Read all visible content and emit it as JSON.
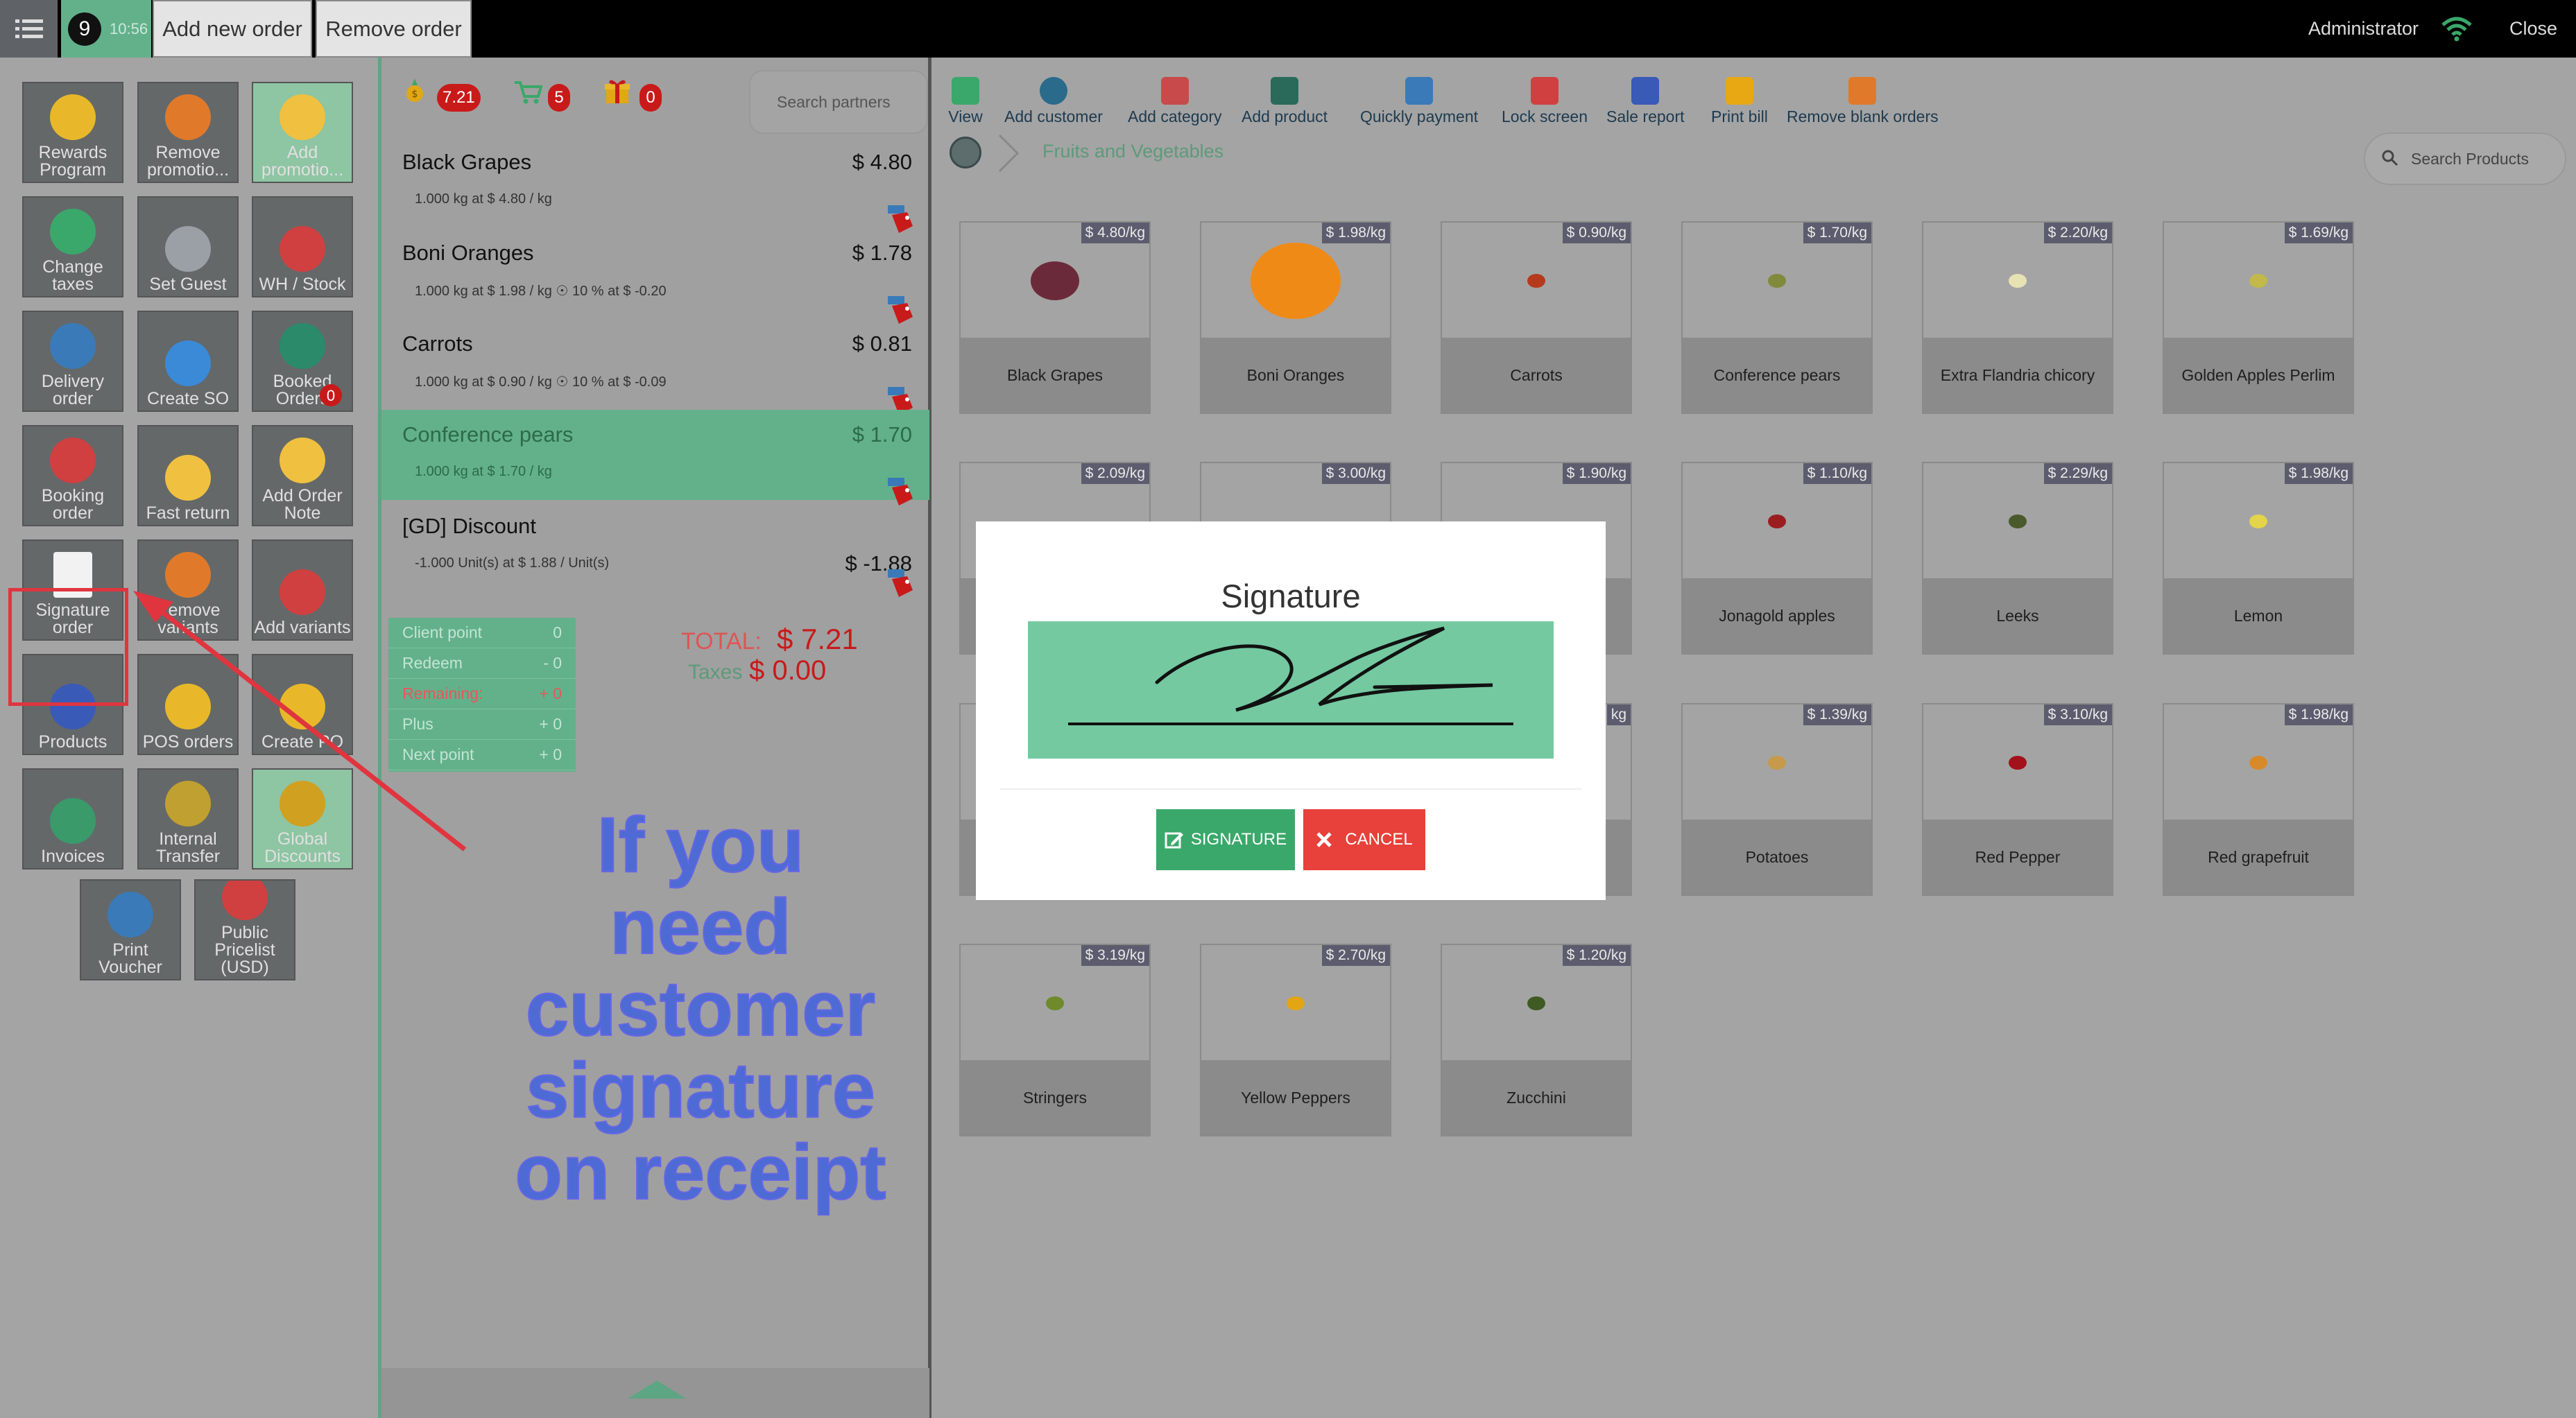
{
  "topbar": {
    "order_number": "9",
    "order_time": "10:56",
    "add_order_label": "Add new order",
    "remove_order_label": "Remove order",
    "user": "Administrator",
    "close_label": "Close"
  },
  "left": {
    "tiles": [
      {
        "label": "Rewards Program",
        "icon": "medal-icon"
      },
      {
        "label": "Remove promotio...",
        "icon": "trash-icon"
      },
      {
        "label": "Add promotio...",
        "icon": "promo-icon"
      },
      {
        "label": "Change taxes",
        "icon": "taxes-icon"
      },
      {
        "label": "Set Guest",
        "icon": "guests-icon"
      },
      {
        "label": "WH / Stock",
        "icon": "warehouse-icon"
      },
      {
        "label": "Delivery order",
        "icon": "delivery-icon"
      },
      {
        "label": "Create SO",
        "icon": "cart-icon"
      },
      {
        "label": "Booked Orders",
        "icon": "booked-icon",
        "badge": "0"
      },
      {
        "label": "Booking order",
        "icon": "booking-icon"
      },
      {
        "label": "Fast return",
        "icon": "coin-icon"
      },
      {
        "label": "Add Order Note",
        "icon": "note-icon"
      },
      {
        "label": "Signature order",
        "icon": "signature-icon"
      },
      {
        "label": "Remove variants",
        "icon": "trash-icon"
      },
      {
        "label": "Add variants",
        "icon": "variants-icon"
      },
      {
        "label": "Products",
        "icon": "barcode-icon"
      },
      {
        "label": "POS orders",
        "icon": "search-orders-icon"
      },
      {
        "label": "Create PO",
        "icon": "basket-icon"
      },
      {
        "label": "Invoices",
        "icon": "invoices-icon"
      },
      {
        "label": "Internal Transfer",
        "icon": "truck-icon"
      },
      {
        "label": "Global Discounts",
        "icon": "discount-tag-icon"
      },
      {
        "label": "Print Voucher",
        "icon": "voucher-icon"
      },
      {
        "label": "Public Pricelist (USD)",
        "icon": "pricelist-icon"
      }
    ]
  },
  "middle": {
    "badges": {
      "points": "7.21",
      "cart": "5",
      "gift": "0"
    },
    "search_placeholder": "Search partners",
    "lines": [
      {
        "name": "Black Grapes",
        "price": "$ 4.80",
        "detail": "1.000 kg at $ 4.80 / kg",
        "discount": ""
      },
      {
        "name": "Boni Oranges",
        "price": "$ 1.78",
        "detail": "1.000 kg at $ 1.98 / kg",
        "discount": "10 % at $ -0.20"
      },
      {
        "name": "Carrots",
        "price": "$ 0.81",
        "detail": "1.000 kg at $ 0.90 / kg",
        "discount": "10 % at $ -0.09"
      },
      {
        "name": "Conference pears",
        "price": "$ 1.70",
        "detail": "1.000 kg at $ 1.70 / kg",
        "discount": ""
      },
      {
        "name": "[GD] Discount",
        "price": "$ -1.88",
        "detail": "-1.000 Unit(s) at $ 1.88 / Unit(s)",
        "discount": ""
      }
    ],
    "points": [
      {
        "label": "Client point",
        "value": "0"
      },
      {
        "label": "Redeem",
        "value": "- 0"
      },
      {
        "label": "Remaining:",
        "value": "+ 0"
      },
      {
        "label": "Plus",
        "value": "+ 0"
      },
      {
        "label": "Next point",
        "value": "+ 0"
      }
    ],
    "total_label": "TOTAL:",
    "total_value": "$ 7.21",
    "taxes_label": "Taxes",
    "taxes_value": "$ 0.00"
  },
  "right": {
    "toolbar": [
      {
        "label": "View",
        "icon": "checklist-icon"
      },
      {
        "label": "Add customer",
        "icon": "user-icon"
      },
      {
        "label": "Add category",
        "icon": "hierarchy-icon"
      },
      {
        "label": "Add product",
        "icon": "add-product-icon"
      },
      {
        "label": "Quickly payment",
        "icon": "payment-icon"
      },
      {
        "label": "Lock screen",
        "icon": "monitor-icon"
      },
      {
        "label": "Sale report",
        "icon": "report-icon"
      },
      {
        "label": "Print bill",
        "icon": "printer-icon"
      },
      {
        "label": "Remove blank orders",
        "icon": "trash-icon"
      }
    ],
    "breadcrumb": "Fruits and Vegetables",
    "search_placeholder": "Search Products",
    "products": [
      {
        "name": "Black Grapes",
        "price": "$ 4.80/kg",
        "color": "#6b2a3a"
      },
      {
        "name": "Boni Oranges",
        "price": "$ 1.98/kg",
        "color": "#f08a16"
      },
      {
        "name": "Carrots",
        "price": "$ 0.90/kg",
        "color": "#b53a1c"
      },
      {
        "name": "Conference pears",
        "price": "$ 1.70/kg",
        "color": "#7f8a3a"
      },
      {
        "name": "Extra Flandria chicory",
        "price": "$ 2.20/kg",
        "color": "#e7e2b4"
      },
      {
        "name": "Golden Apples Perlim",
        "price": "$ 1.69/kg",
        "color": "#c2b94a"
      },
      {
        "name": "",
        "price": "$ 2.09/kg",
        "color": ""
      },
      {
        "name": "",
        "price": "$ 3.00/kg",
        "color": ""
      },
      {
        "name": "",
        "price": "$ 1.90/kg",
        "color": ""
      },
      {
        "name": "Jonagold apples",
        "price": "$ 1.10/kg",
        "color": "#9b1d20"
      },
      {
        "name": "Leeks",
        "price": "$ 2.29/kg",
        "color": "#4a5a2c"
      },
      {
        "name": "Lemon",
        "price": "$ 1.98/kg",
        "color": "#e4d44a"
      },
      {
        "name": "",
        "price": "",
        "color": ""
      },
      {
        "name": "",
        "price": "",
        "color": ""
      },
      {
        "name": "",
        "price": "kg",
        "color": ""
      },
      {
        "name": "Potatoes",
        "price": "$ 1.39/kg",
        "color": "#c69a4a"
      },
      {
        "name": "Red Pepper",
        "price": "$ 3.10/kg",
        "color": "#a3121b"
      },
      {
        "name": "Red grapefruit",
        "price": "$ 1.98/kg",
        "color": "#d88a2a"
      },
      {
        "name": "Stringers",
        "price": "$ 3.19/kg",
        "color": "#6f8a2a"
      },
      {
        "name": "Yellow Peppers",
        "price": "$ 2.70/kg",
        "color": "#e2a514"
      },
      {
        "name": "Zucchini",
        "price": "$ 1.20/kg",
        "color": "#3f5a22"
      }
    ]
  },
  "annotation": "If you need customer signature on receipt",
  "modal": {
    "title": "Signature",
    "sign_label": "SIGNATURE",
    "cancel_label": "CANCEL"
  },
  "colors": {
    "accent_green": "#62b18b",
    "badge_red": "#c91a1a",
    "highlight_red": "#e0353f",
    "annotation_blue": "#3d5fe0"
  }
}
